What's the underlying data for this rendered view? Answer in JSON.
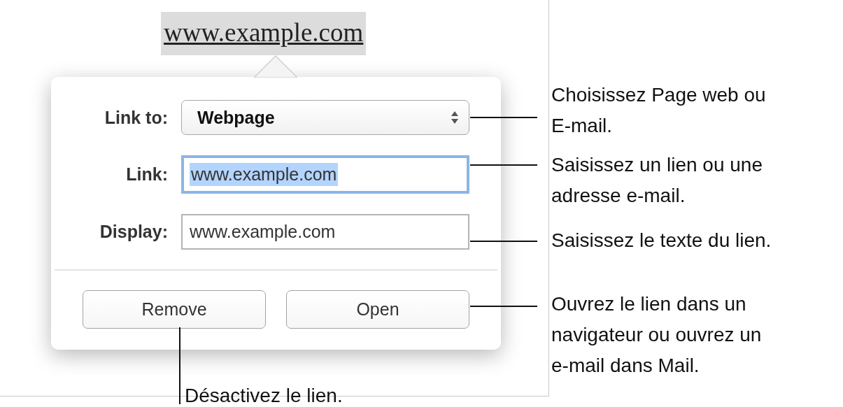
{
  "document": {
    "link_text": "www.example.com"
  },
  "popover": {
    "fields": [
      {
        "kind": "select",
        "label": "Link to:",
        "value": "Webpage"
      },
      {
        "kind": "text",
        "label": "Link:",
        "value": "www.example.com",
        "focused": true
      },
      {
        "kind": "text",
        "label": "Display:",
        "value": "www.example.com",
        "focused": false
      }
    ],
    "buttons": [
      {
        "label": "Remove"
      },
      {
        "label": "Open"
      }
    ]
  },
  "callouts": [
    {
      "lines": [
        "Choisissez Page web ou",
        "E-mail."
      ]
    },
    {
      "lines": [
        "Saisissez un lien ou une",
        "adresse e-mail."
      ]
    },
    {
      "lines": [
        "Saisissez le texte du lien."
      ]
    },
    {
      "lines": [
        "Ouvrez le lien dans un",
        "navigateur ou ouvrez un",
        "e-mail dans Mail."
      ]
    },
    {
      "lines": [
        "Désactivez le lien."
      ]
    }
  ]
}
